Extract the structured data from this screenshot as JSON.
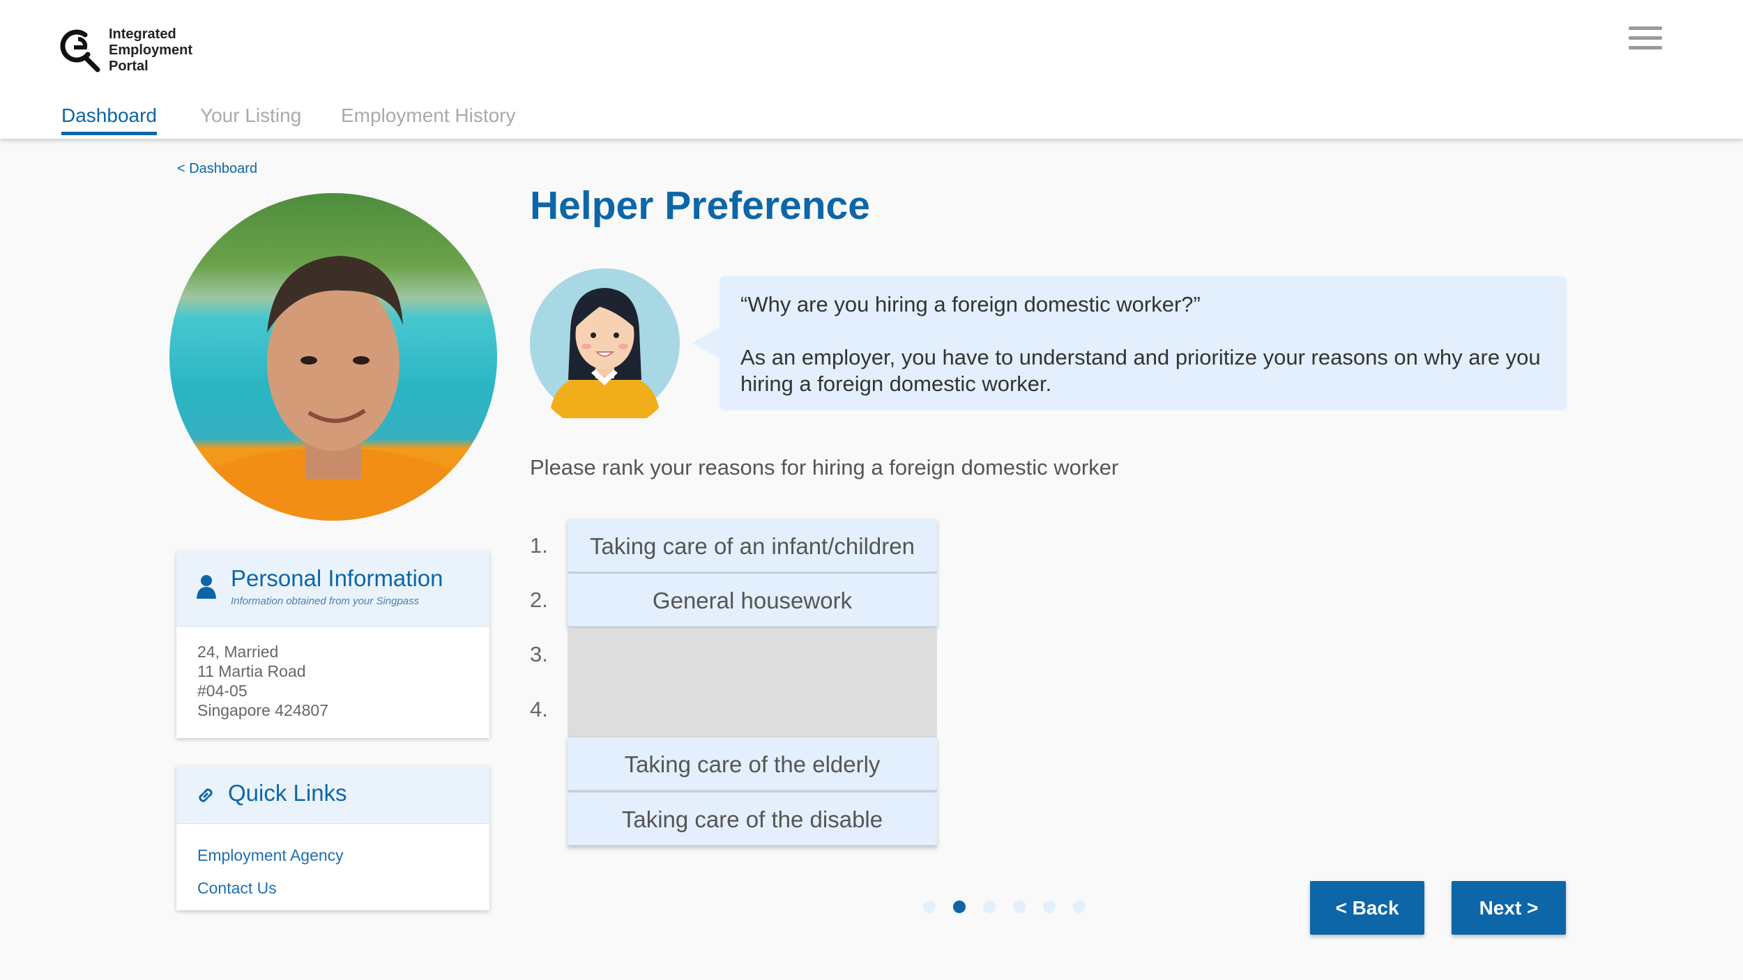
{
  "app": {
    "logo_lines": [
      "Integrated",
      "Employment",
      "Portal"
    ]
  },
  "nav": {
    "tabs": [
      {
        "label": "Dashboard",
        "active": true
      },
      {
        "label": "Your Listing",
        "active": false
      },
      {
        "label": "Employment History",
        "active": false
      }
    ]
  },
  "breadcrumb": "< Dashboard",
  "personal_info": {
    "title": "Personal Information",
    "subtitle": "Information obtained from your Singpass",
    "lines": [
      "24, Married",
      "11 Martia Road",
      "#04-05",
      "Singapore 424807"
    ]
  },
  "quick_links": {
    "title": "Quick Links",
    "links": [
      "Employment Agency",
      "Contact Us"
    ]
  },
  "main": {
    "title": "Helper Preference",
    "bubble_question": "“Why are you hiring a foreign domestic worker?”",
    "bubble_text": "As an employer, you have to understand and prioritize your reasons on why are you hiring a foreign domestic worker.",
    "instruction": "Please rank your reasons for hiring a foreign domestic worker",
    "rank_numbers": [
      "1.",
      "2.",
      "3.",
      "4."
    ],
    "ranked": [
      "Taking care of an infant/children",
      "General housework"
    ],
    "unranked": [
      "Taking care of the elderly",
      "Taking care of the disable"
    ]
  },
  "pager": {
    "total": 6,
    "active_index": 1
  },
  "buttons": {
    "back": "< Back",
    "next": "Next >"
  },
  "colors": {
    "brand": "#0c66a8",
    "item_bg": "#e3effc",
    "slot_bg": "#dddddd"
  }
}
